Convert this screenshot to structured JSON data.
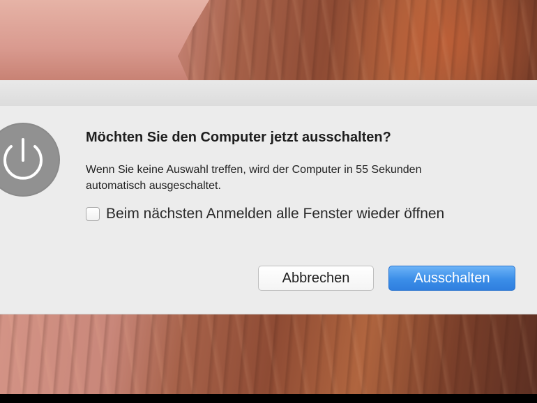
{
  "dialog": {
    "title": "Möchten Sie den Computer jetzt ausschalten?",
    "message": "Wenn Sie keine Auswahl treffen, wird der Computer in 55 Sekunden automatisch ausgeschaltet.",
    "checkbox": {
      "label": "Beim nächsten Anmelden alle Fenster wieder öffnen",
      "checked": false
    },
    "buttons": {
      "cancel_label": "Abbrechen",
      "primary_label": "Ausschalten"
    },
    "icon": "power-icon"
  },
  "colors": {
    "primary_button": "#3b8ee8",
    "dialog_background": "#ececec",
    "icon_gray": "#8a8a8a"
  }
}
